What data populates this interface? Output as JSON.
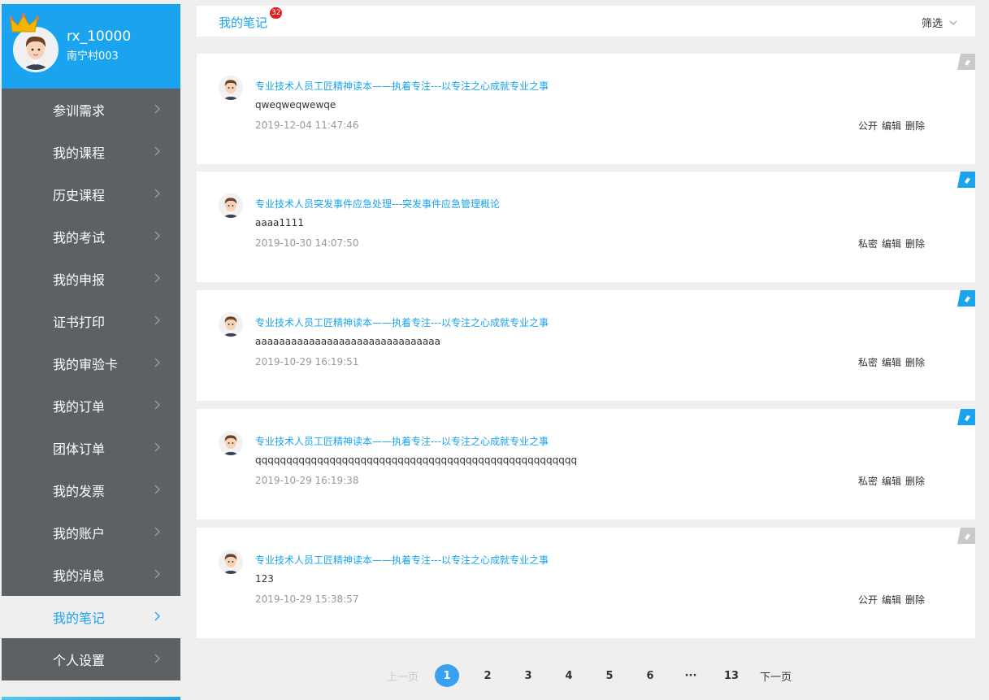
{
  "profile": {
    "username": "rx_10000",
    "org": "南宁村003"
  },
  "menu": [
    {
      "label": "参训需求",
      "active": false
    },
    {
      "label": "我的课程",
      "active": false
    },
    {
      "label": "历史课程",
      "active": false
    },
    {
      "label": "我的考试",
      "active": false
    },
    {
      "label": "我的申报",
      "active": false
    },
    {
      "label": "证书打印",
      "active": false
    },
    {
      "label": "我的审验卡",
      "active": false
    },
    {
      "label": "我的订单",
      "active": false
    },
    {
      "label": "团体订单",
      "active": false
    },
    {
      "label": "我的发票",
      "active": false
    },
    {
      "label": "我的账户",
      "active": false
    },
    {
      "label": "我的消息",
      "active": false
    },
    {
      "label": "我的笔记",
      "active": true
    },
    {
      "label": "个人设置",
      "active": false
    }
  ],
  "header": {
    "title": "我的笔记",
    "badge": "32",
    "filter_label": "筛选"
  },
  "notes": [
    {
      "title": "专业技术人员工匠精神读本——执着专注---以专注之心成就专业之事",
      "body": "qweqweqwewqe",
      "time": "2019-12-04 11:47:46",
      "visibility": "公开",
      "edit": "编辑",
      "delete": "删除",
      "corner": "grey"
    },
    {
      "title": "专业技术人员突发事件应急处理---突发事件应急管理概论",
      "body": "aaaa1111",
      "time": "2019-10-30 14:07:50",
      "visibility": "私密",
      "edit": "编辑",
      "delete": "删除",
      "corner": "blue"
    },
    {
      "title": "专业技术人员工匠精神读本——执着专注---以专注之心成就专业之事",
      "body": "aaaaaaaaaaaaaaaaaaaaaaaaaaaaaaa",
      "time": "2019-10-29 16:19:51",
      "visibility": "私密",
      "edit": "编辑",
      "delete": "删除",
      "corner": "blue"
    },
    {
      "title": "专业技术人员工匠精神读本——执着专注---以专注之心成就专业之事",
      "body": "qqqqqqqqqqqqqqqqqqqqqqqqqqqqqqqqqqqqqqqqqqqqqqqqqqqq",
      "time": "2019-10-29 16:19:38",
      "visibility": "私密",
      "edit": "编辑",
      "delete": "删除",
      "corner": "blue"
    },
    {
      "title": "专业技术人员工匠精神读本——执着专注---以专注之心成就专业之事",
      "body": "123",
      "time": "2019-10-29 15:38:57",
      "visibility": "公开",
      "edit": "编辑",
      "delete": "删除",
      "corner": "grey"
    }
  ],
  "pagination": {
    "prev": "上一页",
    "next": "下一页",
    "pages": [
      "1",
      "2",
      "3",
      "4",
      "5",
      "6",
      "···",
      "13"
    ],
    "current": "1"
  },
  "colors": {
    "accent": "#1aa3ee",
    "sidebar": "#5d6064",
    "corner_grey": "#c9c9c9",
    "corner_blue": "#1aa3ee"
  }
}
